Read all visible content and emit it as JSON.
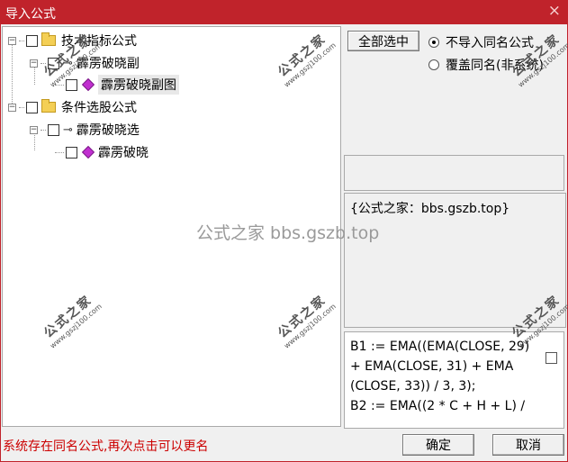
{
  "window": {
    "title": "导入公式",
    "close_glyph": "×"
  },
  "tree": {
    "nodes": [
      {
        "label": "技术指标公式",
        "type": "folder",
        "expander": "−"
      },
      {
        "label": "霹雳破晓副",
        "type": "key",
        "expander": "−"
      },
      {
        "label": "霹雳破晓副图",
        "type": "gem"
      },
      {
        "label": "条件选股公式",
        "type": "folder",
        "expander": "−"
      },
      {
        "label": "霹雳破晓选",
        "type": "key",
        "expander": "−"
      },
      {
        "label": "霹雳破晓",
        "type": "gem"
      }
    ]
  },
  "controls": {
    "select_all_label": "全部选中",
    "radio_no_import": "不导入同名公式",
    "radio_overwrite": "覆盖同名(非系统)",
    "radio_selected": "no_import"
  },
  "description": {
    "text": "{公式之家：bbs.gszb.top}"
  },
  "code": {
    "text": "B1 := EMA((EMA(CLOSE, 29)\n+ EMA(CLOSE, 31) + EMA\n(CLOSE, 33)) / 3, 3);\nB2 := EMA((2 * C + H + L) /"
  },
  "footer": {
    "status": "系统存在同名公式,再次点击可以更名",
    "ok_label": "确定",
    "cancel_label": "取消"
  },
  "watermarks": {
    "center": "公式之家 bbs.gszb.top",
    "stamp_big": "公式之家",
    "stamp_small": "www.gszj100.com"
  },
  "colors": {
    "titlebar": "#c0232b",
    "status": "#cc0000",
    "gem": "#c12fd0"
  }
}
